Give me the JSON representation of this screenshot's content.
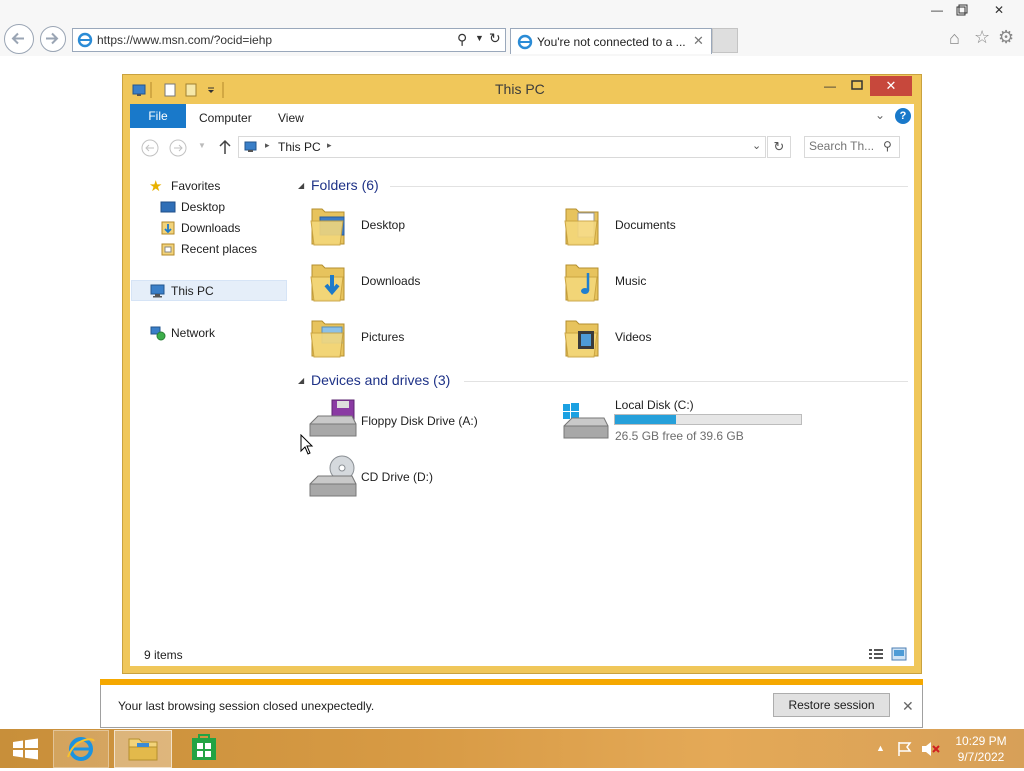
{
  "browser": {
    "address_url": "https://www.msn.com/?ocid=iehp",
    "tab_title": "You're not connected to a ..."
  },
  "explorer": {
    "title": "This PC",
    "ribbon_tabs": [
      "File",
      "Computer",
      "View"
    ],
    "breadcrumb": "This PC",
    "search_placeholder": "Search Th...",
    "nav": {
      "favorites": "Favorites",
      "favorites_items": [
        "Desktop",
        "Downloads",
        "Recent places"
      ],
      "this_pc": "This PC",
      "network": "Network"
    },
    "folders_header": "Folders (6)",
    "folders": [
      "Desktop",
      "Documents",
      "Downloads",
      "Music",
      "Pictures",
      "Videos"
    ],
    "devices_header": "Devices and drives (3)",
    "devices": {
      "floppy": "Floppy Disk Drive (A:)",
      "local_disk": "Local Disk (C:)",
      "local_disk_free": "26.5 GB free of 39.6 GB",
      "local_disk_used_fraction": 0.33,
      "cd": "CD Drive (D:)"
    },
    "status_items": "9 items"
  },
  "notification": {
    "message": "Your last browsing session closed unexpectedly.",
    "restore_label": "Restore session"
  },
  "taskbar": {
    "time": "10:29 PM",
    "date": "9/7/2022"
  },
  "colors": {
    "accent_file_tab": "#1979ca",
    "window_frame": "#f0c75a",
    "close_button": "#c7483c",
    "disk_bar": "#26a0da",
    "notification_stripe": "#f5a800"
  }
}
